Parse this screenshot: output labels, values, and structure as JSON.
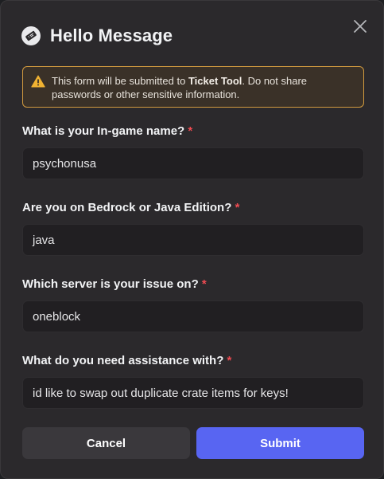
{
  "modal": {
    "title": "Hello Message",
    "notice": {
      "prefix": "This form will be submitted to ",
      "app_name": "Ticket Tool",
      "suffix": ". Do not share passwords or other sensitive information."
    },
    "fields": [
      {
        "label": "What is your In-game name?",
        "required_mark": "*",
        "value": "psychonusa"
      },
      {
        "label": "Are you on Bedrock or Java Edition?",
        "required_mark": "*",
        "value": "java"
      },
      {
        "label": "Which server is your issue on?",
        "required_mark": "*",
        "value": "oneblock"
      },
      {
        "label": "What do you need assistance with?",
        "required_mark": "*",
        "value": "id like to swap out duplicate crate items for keys!"
      }
    ],
    "buttons": {
      "cancel": "Cancel",
      "submit": "Submit"
    },
    "colors": {
      "accent": "#5865f2",
      "warning": "#f0b232",
      "required": "#f04b52"
    },
    "icons": {
      "app": "ticket-icon",
      "close": "close-icon",
      "warning": "warning-icon"
    }
  }
}
